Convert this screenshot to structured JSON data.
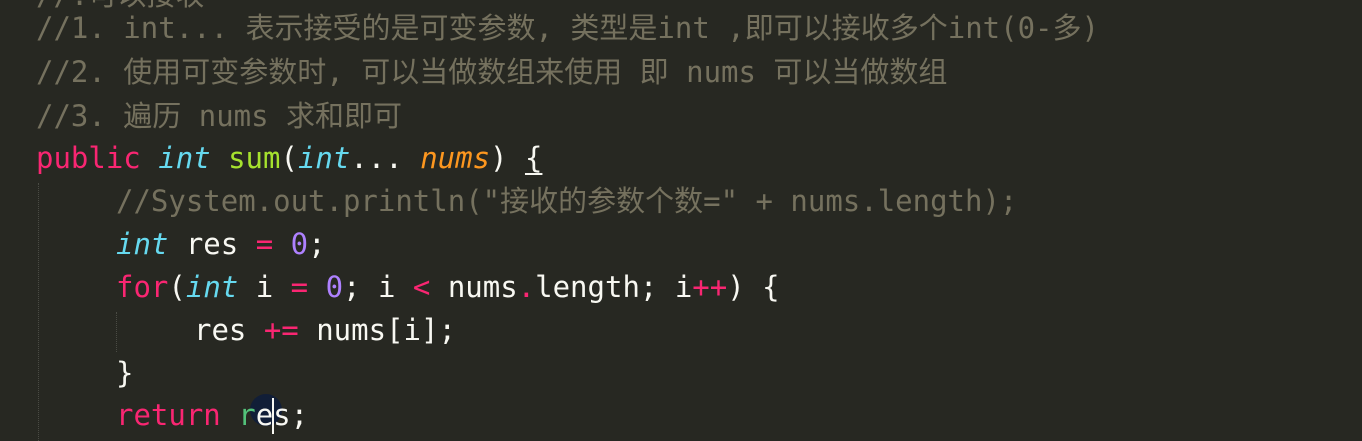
{
  "code": {
    "line0": "//.可以接收",
    "line1": "//1. int... 表示接受的是可变参数, 类型是int ,即可以接收多个int(0-多)",
    "line2": "//2. 使用可变参数时, 可以当做数组来使用 即 nums 可以当做数组",
    "line3": "//3. 遍历 nums 求和即可",
    "line4": {
      "kw_public": "public",
      "type_int": "int",
      "fn_name": "sum",
      "open_paren": "(",
      "param_type": "int",
      "varargs": "...",
      "param_name": "nums",
      "close_paren": ") ",
      "open_brace": "{"
    },
    "line5": "//System.out.println(\"接收的参数个数=\" + nums.length);",
    "line6": {
      "type_int": "int",
      "var": " res ",
      "assign": "=",
      "sp": " ",
      "zero": "0",
      "semi": ";"
    },
    "line7": {
      "kw_for": "for",
      "open": "(",
      "type_int": "int",
      "var_i": " i ",
      "assign": "=",
      "sp1": " ",
      "zero": "0",
      "mid1": "; i ",
      "lt": "<",
      "mid2": " nums",
      "dot": ".",
      "length": "length; i",
      "inc": "++",
      "close": ") {"
    },
    "line8": {
      "lhs": "res ",
      "op": "+=",
      "rhs": " nums[i];"
    },
    "line9": "}",
    "line10": {
      "kw_return": "return",
      "sp": " ",
      "r": "r",
      "rest": "es;"
    }
  },
  "colors": {
    "background": "#272822",
    "comment": "#75715e",
    "keyword": "#f92672",
    "type": "#66d9ef",
    "function": "#a6e22e",
    "parameter": "#fd971f",
    "number": "#ae81ff",
    "text": "#f8f8f2"
  }
}
